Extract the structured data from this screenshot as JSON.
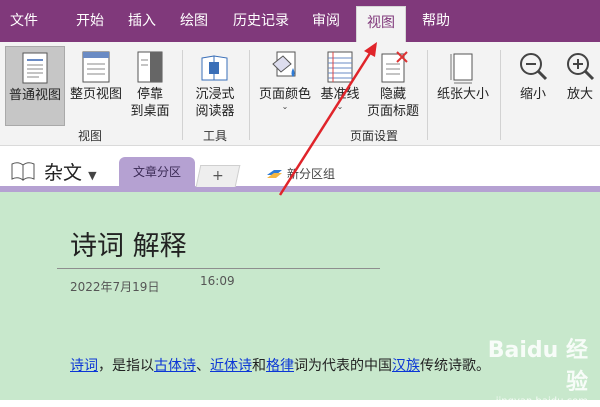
{
  "menu": {
    "items": [
      "文件",
      "开始",
      "插入",
      "绘图",
      "历史记录",
      "审阅",
      "视图",
      "帮助"
    ],
    "active": "视图"
  },
  "ribbon": {
    "buttons": {
      "normal_view": "普通视图",
      "full_page_view": "整页视图",
      "dock_to_desktop_line1": "停靠",
      "dock_to_desktop_line2": "到桌面",
      "immersive_reader_line1": "沉浸式",
      "immersive_reader_line2": "阅读器",
      "page_color": "页面颜色",
      "rule_lines": "基准线",
      "hide_page_title_line1": "隐藏",
      "hide_page_title_line2": "页面标题",
      "paper_size": "纸张大小",
      "zoom_out": "缩小",
      "zoom_in": "放大"
    },
    "groups": {
      "views": "视图",
      "tools": "工具",
      "page_setup": "页面设置"
    }
  },
  "notebook": {
    "name": "杂文",
    "active_section": "文章分区",
    "add_tab": "+",
    "new_section_group": "新分区组"
  },
  "page": {
    "title": "诗词 解释",
    "date": "2022年7月19日",
    "time": "16:09",
    "paragraph": {
      "link1": "诗词",
      "t1": "，是指以",
      "link2": "古体诗",
      "t2": "、",
      "link3": "近体诗",
      "t3": "和",
      "link4": "格律",
      "t4": "词为代表的中国",
      "link5": "汉族",
      "t5": "传统诗歌。"
    }
  },
  "watermark": {
    "main": "Baidu 经验",
    "sub": "jingyan.baidu.com"
  },
  "colors": {
    "menubar": "#80397b",
    "ribbon": "#f3f3f3",
    "section_tab": "#b5a1d2",
    "page_background": "#c8e8cc",
    "link": "#0b36d6",
    "annotation_arrow": "#e0242a"
  }
}
